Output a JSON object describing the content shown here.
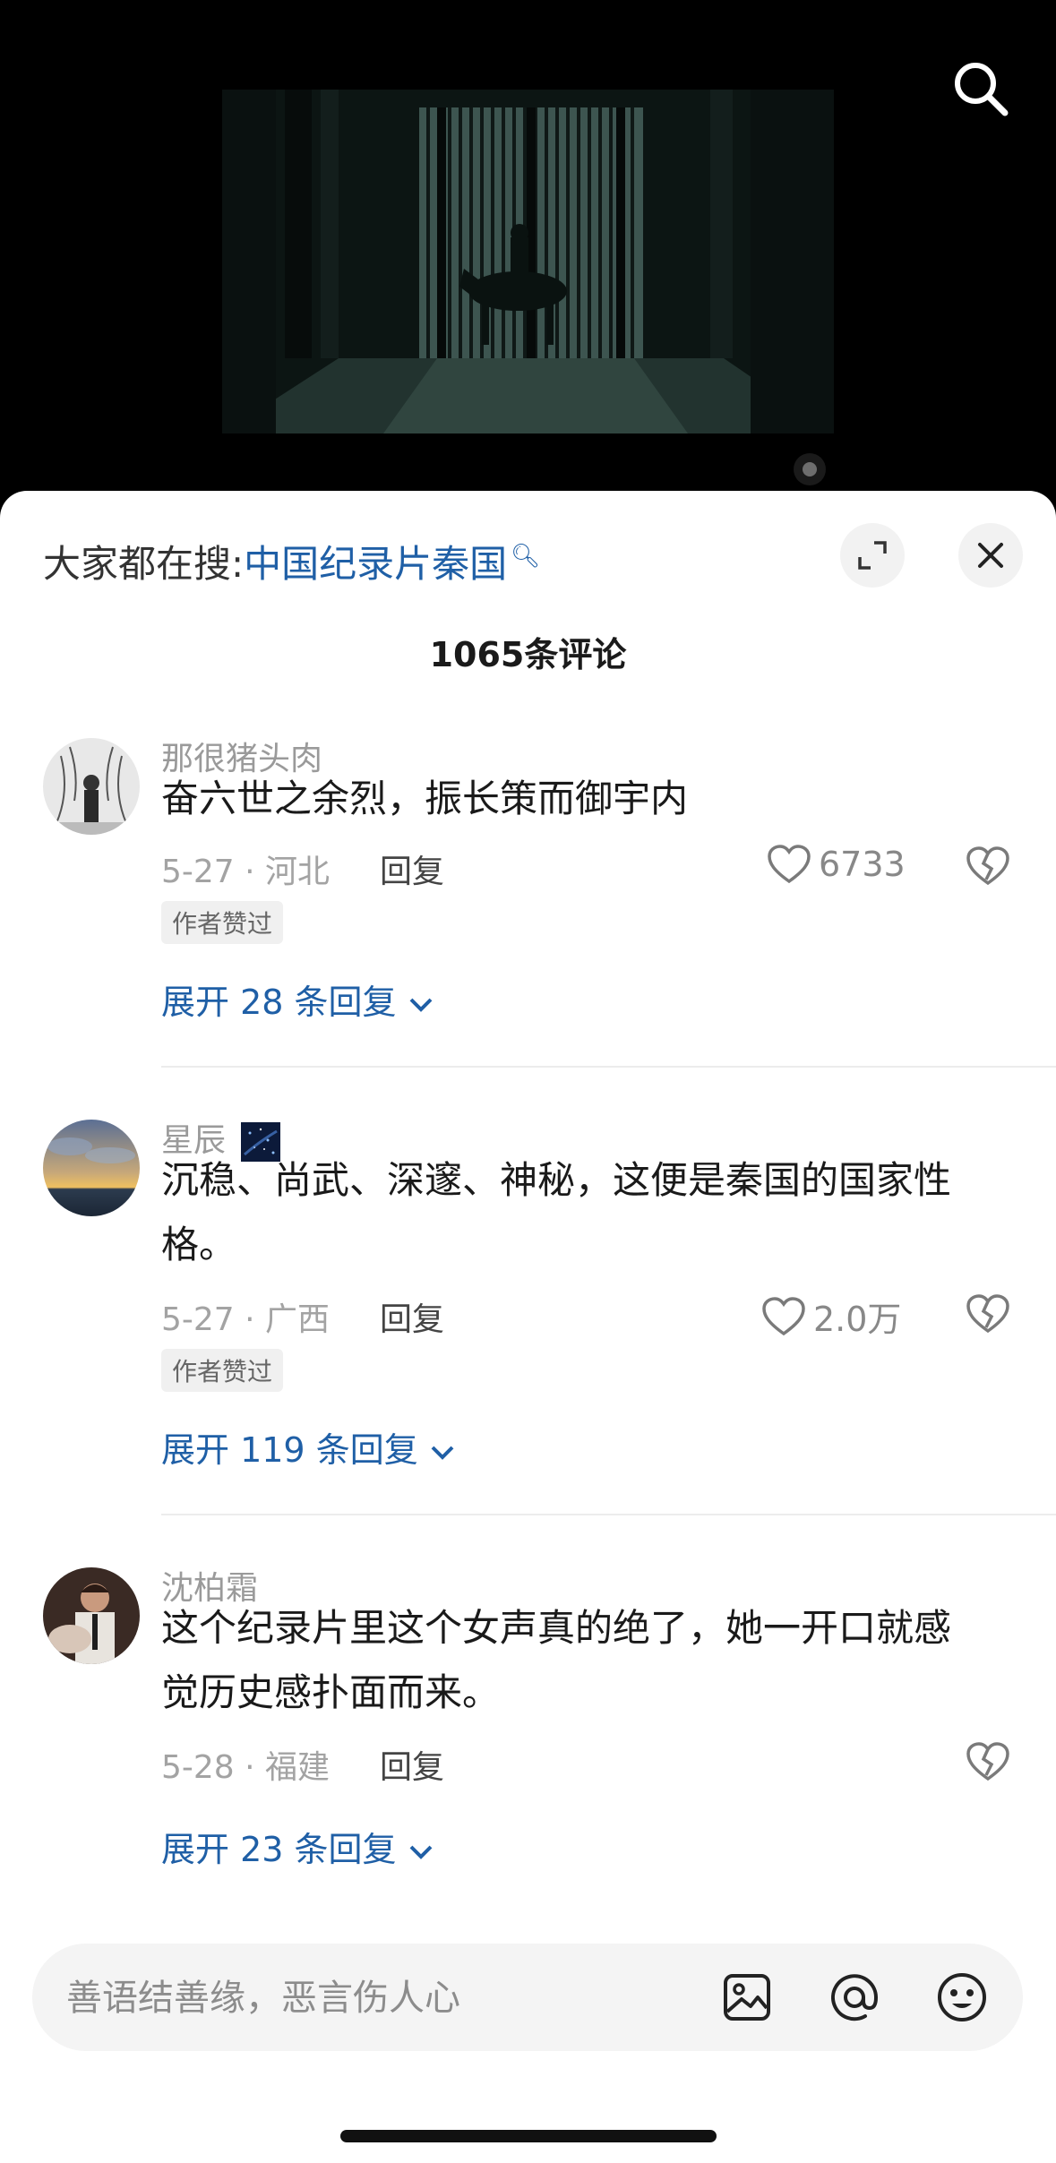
{
  "video": {
    "search_icon": "search-icon",
    "thumbnail_desc_icon": "video-frame"
  },
  "sheet": {
    "hot_search_prefix": "大家都在搜:",
    "hot_search_keyword": "中国纪录片秦国",
    "comment_count": "1065条评论"
  },
  "comments": [
    {
      "username": "那很猪头肉",
      "text": "奋六世之余烈，振长策而御宇内",
      "date_location": "5-27 · 河北",
      "reply_label": "回复",
      "likes": "6733",
      "badge": "作者赞过",
      "expand_label": "展开 28 条回复"
    },
    {
      "username": "星辰",
      "text": "沉稳、尚武、深邃、神秘，这便是秦国的国家性格。",
      "date_location": "5-27 · 广西",
      "reply_label": "回复",
      "likes": "2.0万",
      "badge": "作者赞过",
      "expand_label": "展开 119 条回复"
    },
    {
      "username": "沈柏霜",
      "text": "这个纪录片里这个女声真的绝了，她一开口就感觉历史感扑面而来。",
      "date_location": "5-28 · 福建",
      "reply_label": "回复",
      "expand_label": "展开 23 条回复"
    }
  ],
  "input": {
    "placeholder": "善语结善缘，恶言伤人心"
  },
  "colors": {
    "link": "#1f5fa6",
    "muted": "#9a9a9a",
    "text": "#1a1a1a"
  }
}
